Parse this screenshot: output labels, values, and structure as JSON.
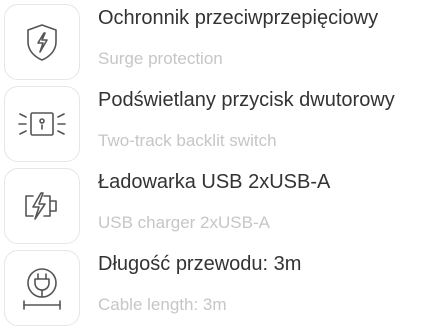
{
  "features": [
    {
      "icon": "surge-shield-icon",
      "title": "Ochronnik przeciwprzepięciowy",
      "subtitle": "Surge protection"
    },
    {
      "icon": "backlit-switch-icon",
      "title": "Podświetlany przycisk dwutorowy",
      "subtitle": "Two-track backlit switch"
    },
    {
      "icon": "usb-charger-icon",
      "title": "Ładowarka USB 2xUSB-A",
      "subtitle": "USB charger 2xUSB-A"
    },
    {
      "icon": "cable-length-icon",
      "title": "Długość przewodu: 3m",
      "subtitle": "Cable length: 3m"
    }
  ],
  "colors": {
    "title": "#333333",
    "subtitle": "#c6c6c6",
    "icon_stroke": "#555555",
    "icon_border": "#e6e6e6"
  }
}
